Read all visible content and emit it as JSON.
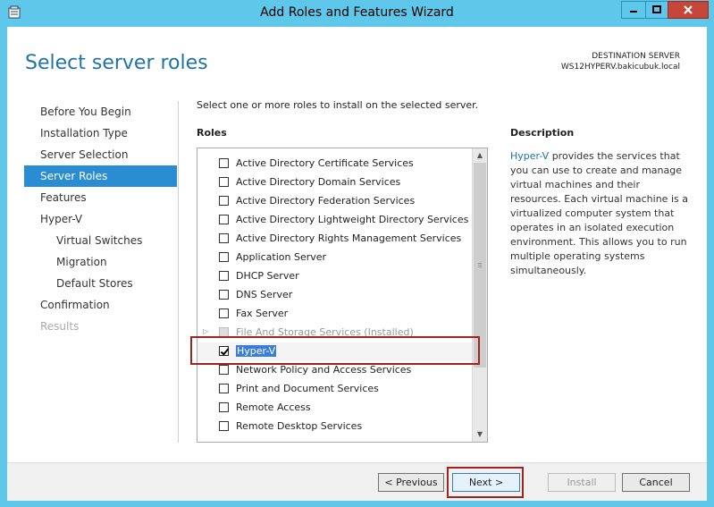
{
  "window": {
    "title": "Add Roles and Features Wizard"
  },
  "page": {
    "title": "Select server roles"
  },
  "destination": {
    "label": "DESTINATION SERVER",
    "server": "WS12HYPERV.bakicubuk.local"
  },
  "nav": {
    "items": [
      {
        "label": "Before You Begin",
        "state": "normal",
        "sub": false
      },
      {
        "label": "Installation Type",
        "state": "normal",
        "sub": false
      },
      {
        "label": "Server Selection",
        "state": "normal",
        "sub": false
      },
      {
        "label": "Server Roles",
        "state": "active",
        "sub": false
      },
      {
        "label": "Features",
        "state": "normal",
        "sub": false
      },
      {
        "label": "Hyper-V",
        "state": "normal",
        "sub": false
      },
      {
        "label": "Virtual Switches",
        "state": "normal",
        "sub": true
      },
      {
        "label": "Migration",
        "state": "normal",
        "sub": true
      },
      {
        "label": "Default Stores",
        "state": "normal",
        "sub": true
      },
      {
        "label": "Confirmation",
        "state": "normal",
        "sub": false
      },
      {
        "label": "Results",
        "state": "disabled",
        "sub": false
      }
    ]
  },
  "main": {
    "instruction": "Select one or more roles to install on the selected server.",
    "roles_header": "Roles",
    "roles": [
      {
        "label": "Active Directory Certificate Services",
        "checked": false
      },
      {
        "label": "Active Directory Domain Services",
        "checked": false
      },
      {
        "label": "Active Directory Federation Services",
        "checked": false
      },
      {
        "label": "Active Directory Lightweight Directory Services",
        "checked": false
      },
      {
        "label": "Active Directory Rights Management Services",
        "checked": false
      },
      {
        "label": "Application Server",
        "checked": false
      },
      {
        "label": "DHCP Server",
        "checked": false
      },
      {
        "label": "DNS Server",
        "checked": false
      },
      {
        "label": "Fax Server",
        "checked": false
      },
      {
        "label": "File And Storage Services (Installed)",
        "checked": false,
        "disabled": true,
        "expandable": true
      },
      {
        "label": "Hyper-V",
        "checked": true,
        "selected": true
      },
      {
        "label": "Network Policy and Access Services",
        "checked": false
      },
      {
        "label": "Print and Document Services",
        "checked": false
      },
      {
        "label": "Remote Access",
        "checked": false
      },
      {
        "label": "Remote Desktop Services",
        "checked": false
      }
    ]
  },
  "description": {
    "header": "Description",
    "link_text": "Hyper-V",
    "text": " provides the services that you can use to create and manage virtual machines and their resources. Each virtual machine is a virtualized computer system that operates in an isolated execution environment. This allows you to run multiple operating systems simultaneously."
  },
  "footer": {
    "previous_label": "< Previous",
    "next_label": "Next >",
    "install_label": "Install",
    "cancel_label": "Cancel"
  },
  "colors": {
    "accent": "#2a8dd4",
    "title_blue": "#1e73a8",
    "highlight_red": "#a0231f",
    "window_frame": "#5fc8ea"
  }
}
